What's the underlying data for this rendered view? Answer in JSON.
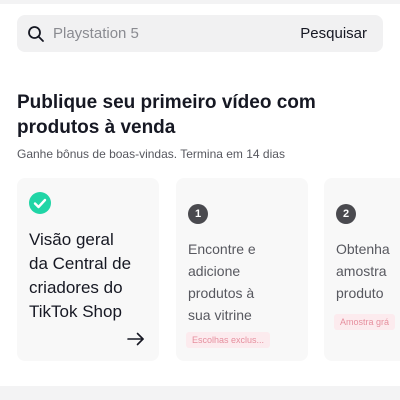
{
  "search": {
    "placeholder": "Playstation 5",
    "button_label": "Pesquisar"
  },
  "section": {
    "title": "Publique seu primeiro vídeo com produtos à venda",
    "subtitle": "Ganhe bônus de boas-vindas. Termina em 14 dias"
  },
  "cards": [
    {
      "status": "completed",
      "lines": [
        "Visão geral",
        "da Central de",
        "criadores do",
        "TikTok Shop"
      ]
    },
    {
      "step": "1",
      "lines": [
        "Encontre e",
        "adicione",
        "produtos à",
        "sua vitrine"
      ],
      "tag": "Escolhas exclus..."
    },
    {
      "step": "2",
      "lines": [
        "Obtenha",
        "amostra",
        "produto"
      ],
      "tag": "Amostra grá"
    }
  ],
  "colors": {
    "accent_green": "#20d5a6",
    "tag_pink": "#e27588"
  }
}
